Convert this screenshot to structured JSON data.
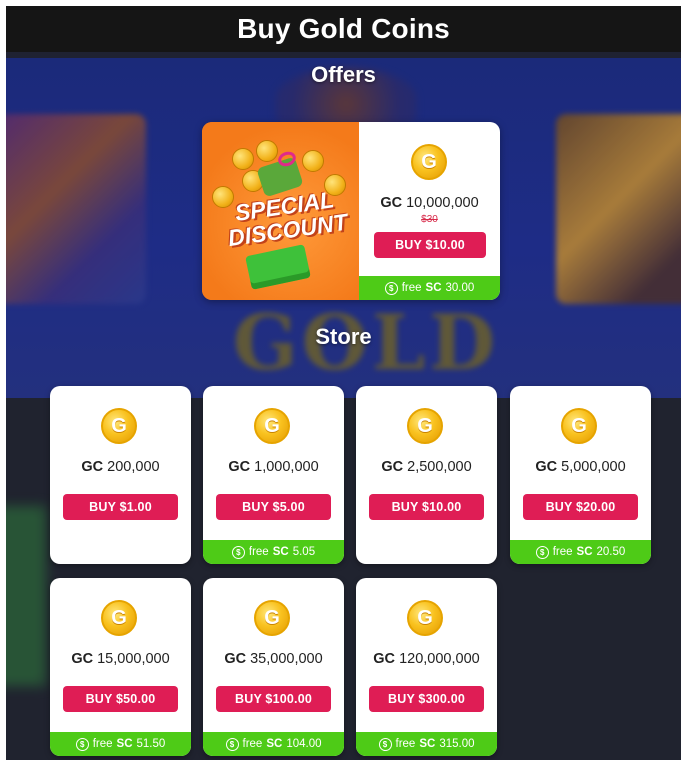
{
  "header": {
    "title": "Buy Gold Coins"
  },
  "sections": {
    "offers": "Offers",
    "store": "Store"
  },
  "background": {
    "logo_text": "GOLD"
  },
  "offer": {
    "art_text_line1": "SPECIAL",
    "art_text_line2": "DISCOUNT",
    "currency": "GC",
    "amount": "10,000,000",
    "old_price": "$30",
    "buy_label": "BUY $10.00",
    "free_prefix": "free",
    "free_currency": "SC",
    "free_amount": "30.00",
    "coin_icon": "gold-coin-icon"
  },
  "store": {
    "items": [
      {
        "currency": "GC",
        "amount": "200,000",
        "buy_label": "BUY $1.00",
        "free_prefix": "",
        "free_currency": "",
        "free_amount": "",
        "has_bonus": false
      },
      {
        "currency": "GC",
        "amount": "1,000,000",
        "buy_label": "BUY $5.00",
        "free_prefix": "free",
        "free_currency": "SC",
        "free_amount": "5.05",
        "has_bonus": true
      },
      {
        "currency": "GC",
        "amount": "2,500,000",
        "buy_label": "BUY $10.00",
        "free_prefix": "",
        "free_currency": "",
        "free_amount": "",
        "has_bonus": false
      },
      {
        "currency": "GC",
        "amount": "5,000,000",
        "buy_label": "BUY $20.00",
        "free_prefix": "free",
        "free_currency": "SC",
        "free_amount": "20.50",
        "has_bonus": true
      },
      {
        "currency": "GC",
        "amount": "15,000,000",
        "buy_label": "BUY $50.00",
        "free_prefix": "free",
        "free_currency": "SC",
        "free_amount": "51.50",
        "has_bonus": true
      },
      {
        "currency": "GC",
        "amount": "35,000,000",
        "buy_label": "BUY $100.00",
        "free_prefix": "free",
        "free_currency": "SC",
        "free_amount": "104.00",
        "has_bonus": true
      },
      {
        "currency": "GC",
        "amount": "120,000,000",
        "buy_label": "BUY $300.00",
        "free_prefix": "free",
        "free_currency": "SC",
        "free_amount": "315.00",
        "has_bonus": true
      }
    ]
  },
  "colors": {
    "buy_button": "#df1d55",
    "bonus_bar": "#4ecb17",
    "offer_art": "#f47a1a",
    "coin": "#f9c21f"
  }
}
